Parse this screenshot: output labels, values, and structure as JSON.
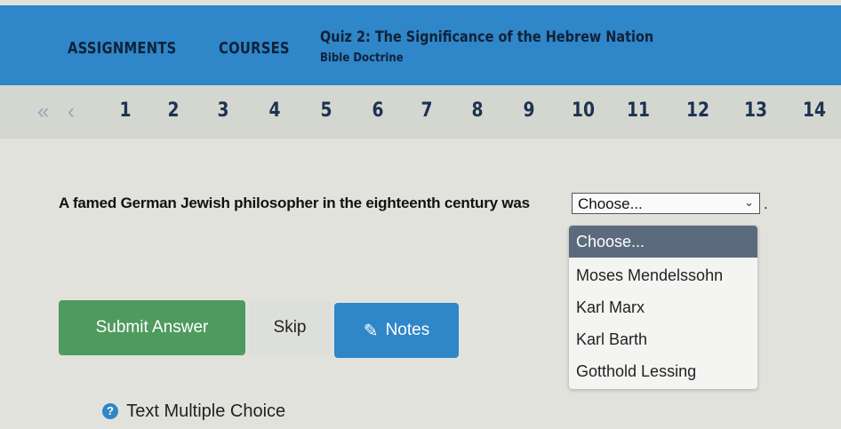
{
  "header": {
    "nav": [
      "ASSIGNMENTS",
      "COURSES"
    ],
    "quiz_title": "Quiz 2: The Significance of the Hebrew Nation",
    "quiz_subtitle": "Bible Doctrine"
  },
  "pager": {
    "first_icon": "double-chevron-left-icon",
    "prev_icon": "chevron-left-icon",
    "pages": [
      "1",
      "2",
      "3",
      "4",
      "5",
      "6",
      "7",
      "8",
      "9",
      "10",
      "11",
      "12",
      "13",
      "14"
    ]
  },
  "question": {
    "text": "A famed German Jewish philosopher in the eighteenth century was",
    "select_value": "Choose...",
    "trailing": "."
  },
  "dropdown": {
    "options": [
      "Choose...",
      "Moses Mendelssohn",
      "Karl Marx",
      "Karl Barth",
      "Gotthold Lessing"
    ],
    "selected_index": 0
  },
  "buttons": {
    "submit": "Submit Answer",
    "skip": "Skip",
    "notes": "Notes",
    "notes_icon": "edit-icon"
  },
  "footer": {
    "type_label": "Text Multiple Choice",
    "help_icon": "question-circle-icon"
  },
  "colors": {
    "header_bg": "#2f86c9",
    "submit_bg": "#4f9a5e",
    "notes_bg": "#2f86c9",
    "selected_option_bg": "#5b6b7d"
  }
}
